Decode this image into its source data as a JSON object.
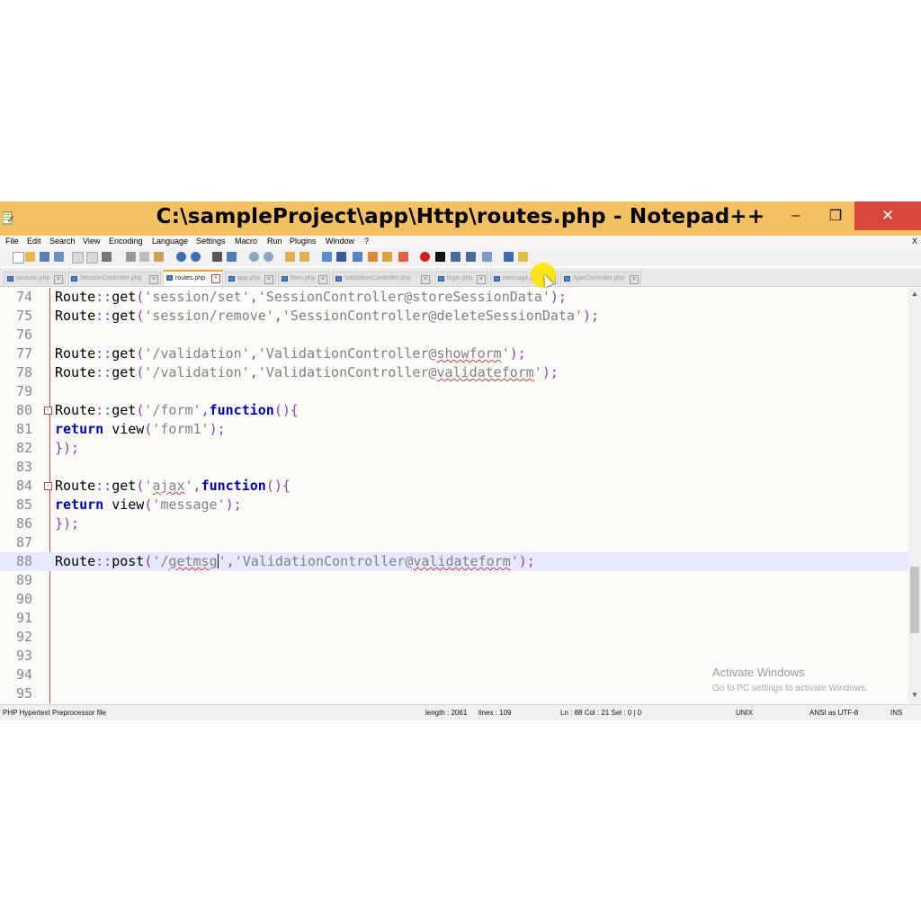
{
  "window": {
    "title": "C:\\sampleProject\\app\\Http\\routes.php - Notepad++",
    "minimize": "–",
    "restore": "❐",
    "close": "✕",
    "menu_close": "X"
  },
  "menu": [
    "File",
    "Edit",
    "Search",
    "View",
    "Encoding",
    "Language",
    "Settings",
    "Macro",
    "Run",
    "Plugins",
    "Window",
    "?"
  ],
  "tabs": [
    {
      "label": "session.php",
      "active": false
    },
    {
      "label": "SessionController.php",
      "active": false
    },
    {
      "label": "routes.php",
      "active": true
    },
    {
      "label": "app.php",
      "active": false
    },
    {
      "label": "form.php",
      "active": false
    },
    {
      "label": "ValidationController.php",
      "active": false
    },
    {
      "label": "login.php",
      "active": false
    },
    {
      "label": "message.php",
      "active": false
    },
    {
      "label": "AjaxController.php",
      "active": false
    }
  ],
  "editor": {
    "line_numbers": [
      "74",
      "75",
      "76",
      "77",
      "78",
      "79",
      "80",
      "81",
      "82",
      "83",
      "84",
      "85",
      "86",
      "87",
      "88",
      "89",
      "90",
      "91",
      "92",
      "93",
      "94",
      "95"
    ],
    "current_line": "88"
  },
  "watermark": {
    "title": "Activate Windows",
    "subtitle": "Go to PC settings to activate Windows."
  },
  "status": {
    "file_type": "PHP Hypertext Preprocessor file",
    "length": "length : 2061",
    "lines": "lines : 109",
    "position": "Ln : 88   Col : 21   Sel : 0 | 0",
    "eol": "UNIX",
    "encoding": "ANSI as UTF-8",
    "mode": "INS"
  },
  "colors": {
    "titlebar": "#f3c062",
    "close_button": "#d9463c",
    "keyword": "#0000c0",
    "string": "#808080",
    "operator": "#8a3fb5",
    "current_line": "#e8e8ff"
  }
}
